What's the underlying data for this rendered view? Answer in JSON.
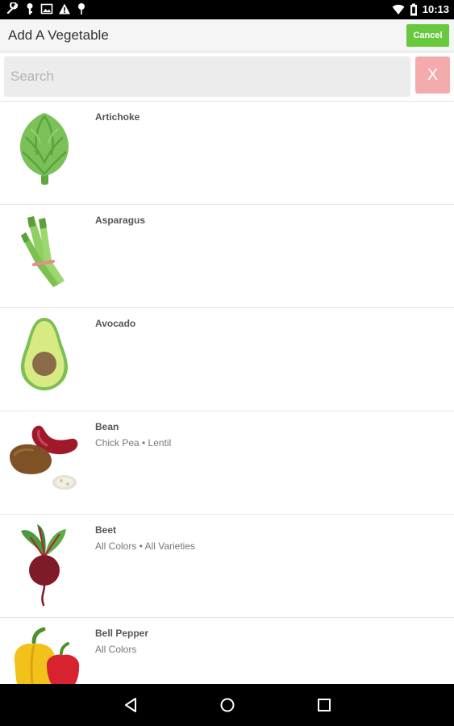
{
  "status_bar": {
    "time": "10:13",
    "left_icons": [
      "wrench-icon",
      "key-icon",
      "image-icon",
      "warning-icon",
      "pin-icon"
    ],
    "right_icons": [
      "wifi-icon",
      "battery-icon"
    ]
  },
  "header": {
    "title": "Add A Vegetable",
    "cancel_label": "Cancel",
    "cancel_color": "#69c93e"
  },
  "search": {
    "placeholder": "Search",
    "value": "",
    "clear_label": "X",
    "clear_color": "#f4abab"
  },
  "vegetables": [
    {
      "name": "Artichoke",
      "subtitle": "",
      "icon": "artichoke-icon"
    },
    {
      "name": "Asparagus",
      "subtitle": "",
      "icon": "asparagus-icon"
    },
    {
      "name": "Avocado",
      "subtitle": "",
      "icon": "avocado-icon"
    },
    {
      "name": "Bean",
      "subtitle": "Chick Pea • Lentil",
      "icon": "bean-icon"
    },
    {
      "name": "Beet",
      "subtitle": "All Colors • All Varieties",
      "icon": "beet-icon"
    },
    {
      "name": "Bell Pepper",
      "subtitle": "All Colors",
      "icon": "bell-pepper-icon"
    }
  ],
  "nav_bar": {
    "buttons": [
      "back-icon",
      "home-icon",
      "recents-icon"
    ]
  }
}
